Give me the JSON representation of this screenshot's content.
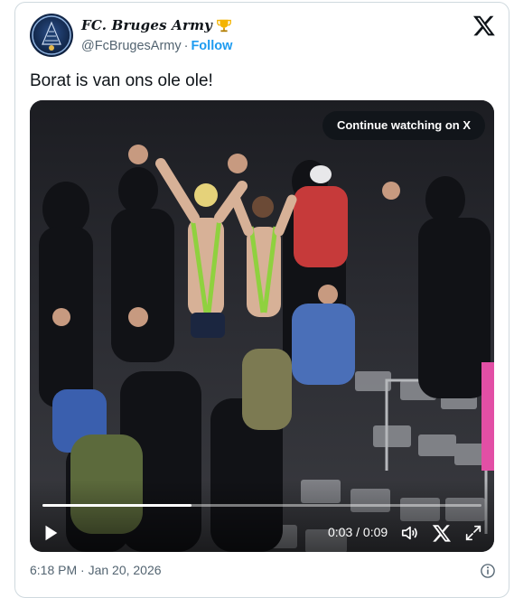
{
  "account": {
    "display_name": "FC. Bruges Army",
    "badge_icon": "trophy-icon",
    "handle": "@FcBrugesArmy",
    "separator": "·",
    "follow_label": "Follow"
  },
  "brand_icon": "x-logo-icon",
  "tweet": {
    "text": "Borat is van ons ole ole!"
  },
  "video": {
    "continue_label": "Continue watching on X",
    "time_display": "0:03 / 0:09",
    "progress_fraction": 0.34,
    "controls": [
      "play-icon",
      "volume-icon",
      "x-logo-icon",
      "fullscreen-icon"
    ]
  },
  "footer": {
    "timestamp": "6:18 PM · Jan 20, 2026",
    "info_icon": "info-icon"
  },
  "colors": {
    "link": "#1d9bf0",
    "text": "#0f1419",
    "muted": "#536471",
    "border": "#cfd9de"
  }
}
